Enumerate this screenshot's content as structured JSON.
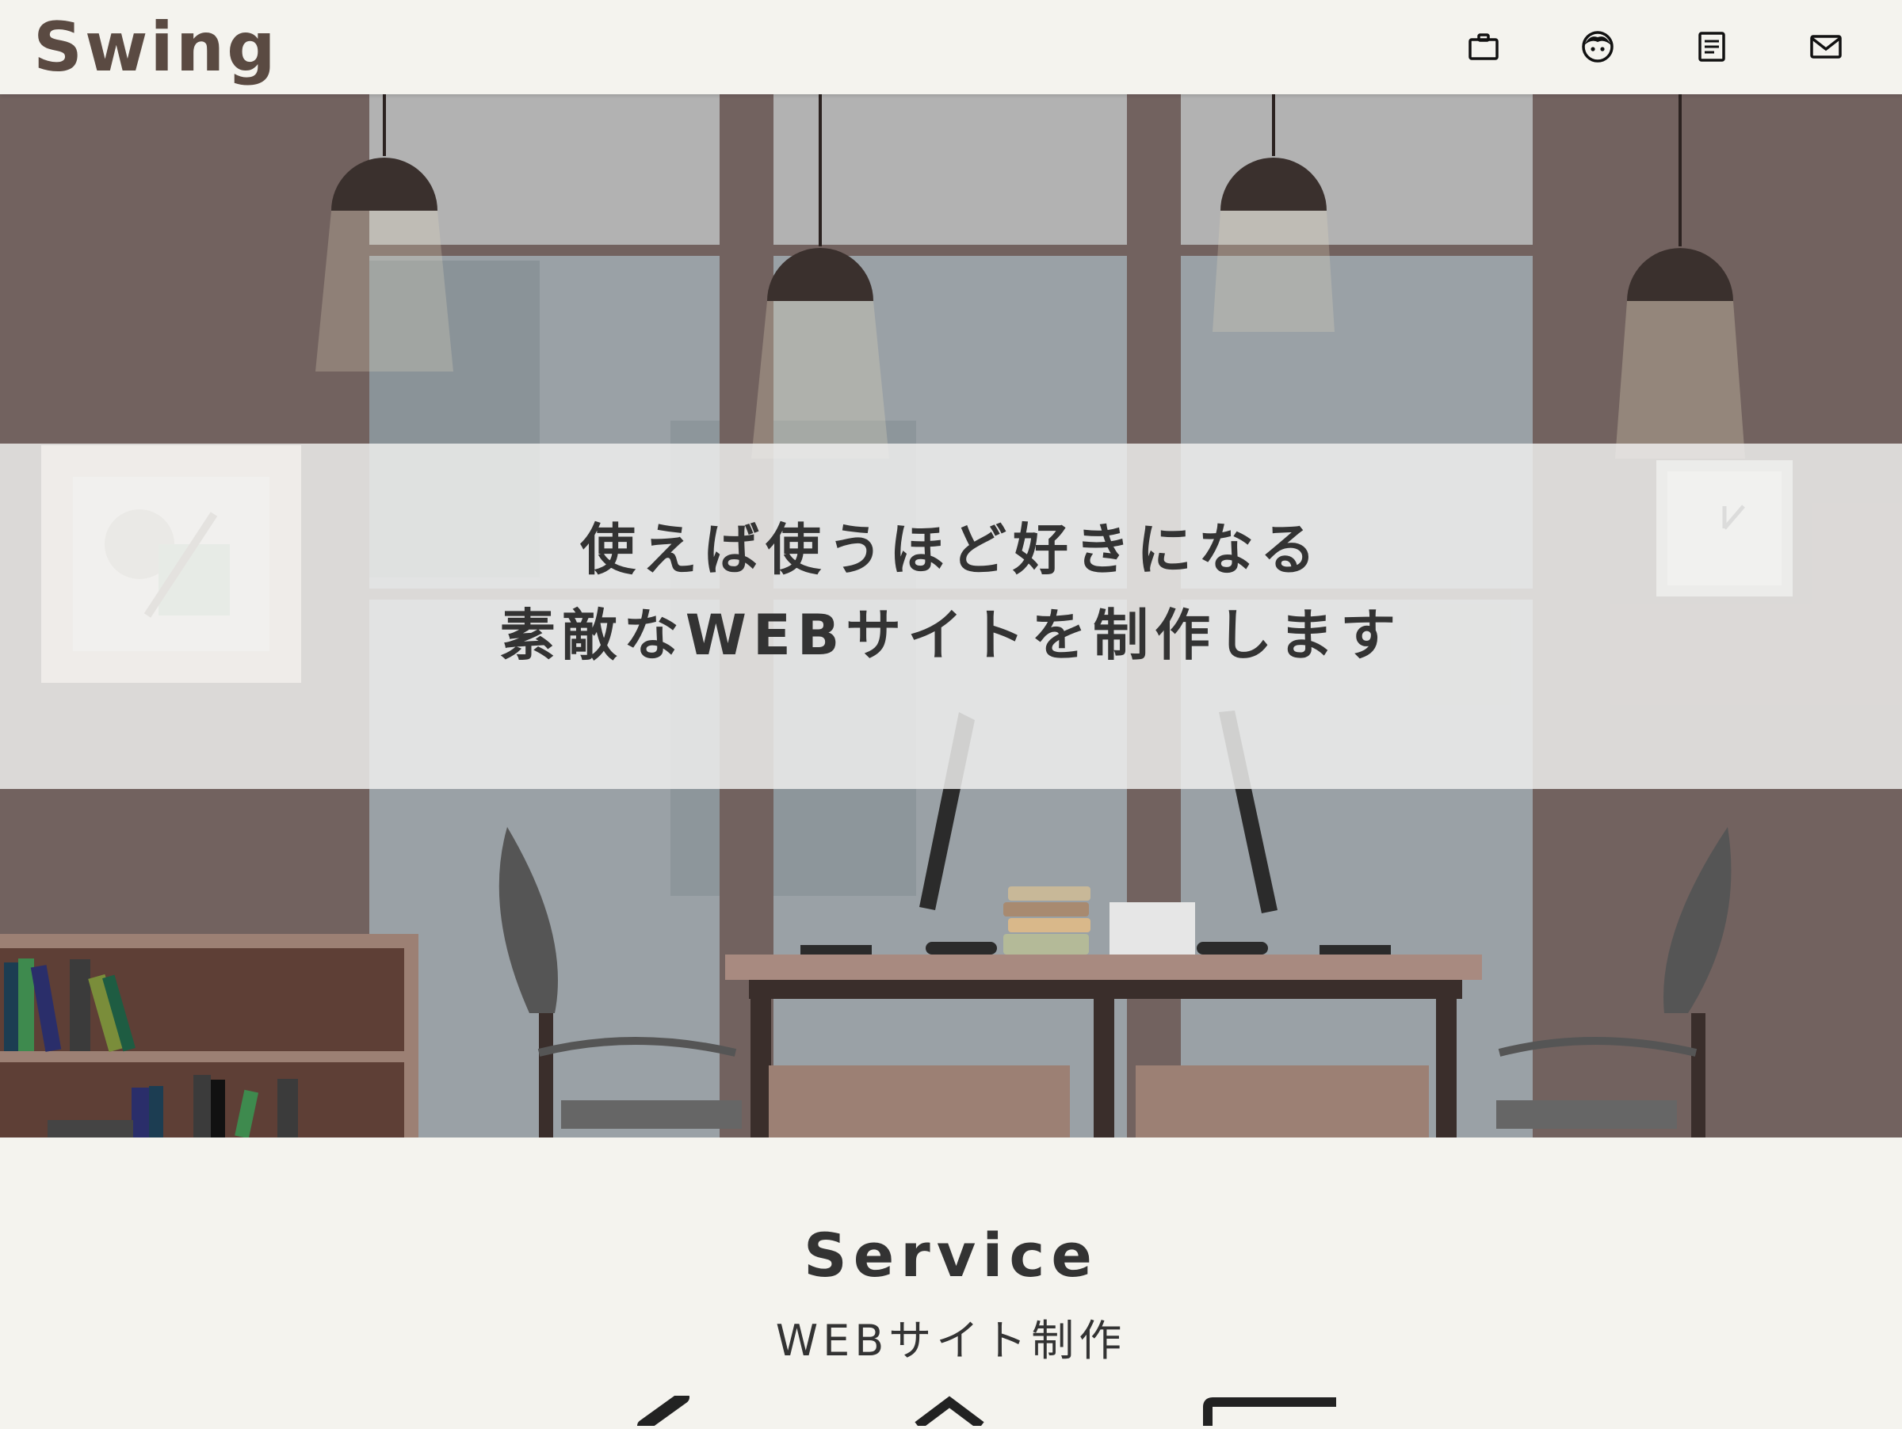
{
  "header": {
    "logo": "Swing",
    "nav": [
      {
        "icon": "briefcase-icon"
      },
      {
        "icon": "face-icon"
      },
      {
        "icon": "document-icon"
      },
      {
        "icon": "mail-icon"
      }
    ]
  },
  "hero": {
    "line1": "使えば使うほど好きになる",
    "line2": "素敵なWEBサイトを制作します"
  },
  "service": {
    "title": "Service",
    "subtitle": "WEBサイト制作",
    "icons": [
      "pen-icon",
      "chevron-icon",
      "monitor-icon"
    ]
  },
  "colors": {
    "background": "#f4f3ee",
    "logo": "#5a4a42",
    "text": "#333333",
    "wall": "#72625f",
    "window": "#9aa1a6"
  }
}
